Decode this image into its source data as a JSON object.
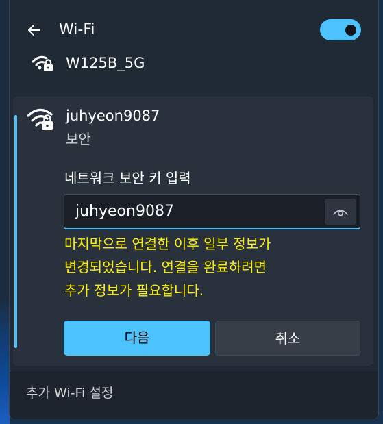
{
  "header": {
    "back_icon": "arrow-left-icon",
    "title": "Wi-Fi",
    "wifi_toggle": "on"
  },
  "networks": {
    "previous": {
      "icon": "wifi-secured-icon",
      "name": "W125B_5G"
    },
    "selected": {
      "icon": "wifi-secured-icon",
      "name": "juhyeon9087",
      "status": "보안",
      "key_label": "네트워크 보안 키 입력",
      "key_value": "juhyeon9087",
      "reveal_icon": "eye-icon",
      "warning_lines": [
        "마지막으로 연결한 이후 일부 정보가",
        "변경되었습니다. 연결을 완료하려면",
        "추가 정보가 필요합니다."
      ],
      "next_label": "다음",
      "cancel_label": "취소"
    }
  },
  "footer": {
    "settings_link": "추가 Wi-Fi 설정"
  },
  "colors": {
    "accent": "#4cc2ff",
    "warning": "#fff000",
    "panel": "#202a35"
  }
}
